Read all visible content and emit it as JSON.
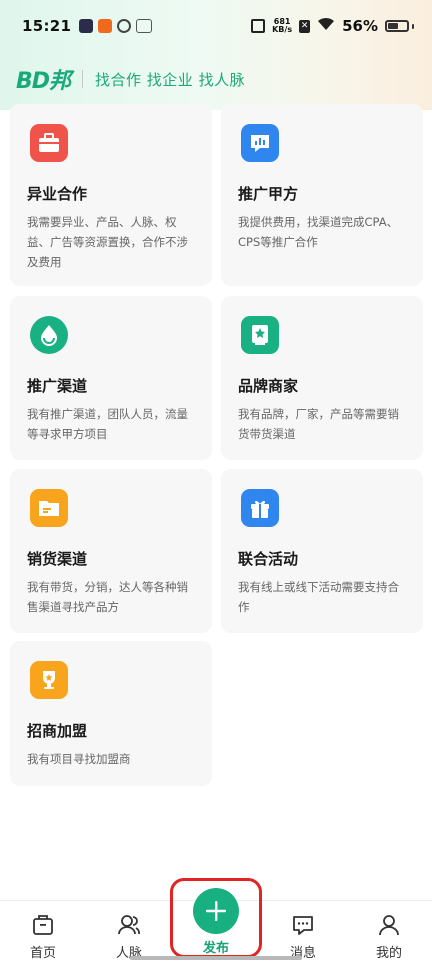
{
  "status_bar": {
    "time": "15:21",
    "net_speed_value": "681",
    "net_speed_unit": "KB/s",
    "battery_percent": "56%",
    "battery_level": 0.56
  },
  "header": {
    "logo": "BD邦",
    "slogan": "找合作 找企业 找人脉"
  },
  "cards": [
    {
      "title": "异业合作",
      "desc": "我需要异业、产品、人脉、权益、广告等资源置换，合作不涉及费用",
      "icon": "briefcase-icon",
      "color": "#f0534a"
    },
    {
      "title": "推广甲方",
      "desc": "我提供费用，找渠道完成CPA、CPS等推广合作",
      "icon": "chart-message-icon",
      "color": "#2f86ee"
    },
    {
      "title": "推广渠道",
      "desc": "我有推广渠道，团队人员，流量等寻求甲方项目",
      "icon": "droplet-icon",
      "color": "#19b184"
    },
    {
      "title": "品牌商家",
      "desc": "我有品牌，厂家，产品等需要销货带货渠道",
      "icon": "brand-book-icon",
      "color": "#19b184"
    },
    {
      "title": "销货渠道",
      "desc": "我有带货，分销，达人等各种销售渠道寻找产品方",
      "icon": "folder-icon",
      "color": "#f8a51d"
    },
    {
      "title": "联合活动",
      "desc": "我有线上或线下活动需要支持合作",
      "icon": "gift-icon",
      "color": "#2f86ee"
    },
    {
      "title": "招商加盟",
      "desc": "我有项目寻找加盟商",
      "icon": "trophy-icon",
      "color": "#f8a51d"
    }
  ],
  "tabbar": {
    "home": "首页",
    "contacts": "人脉",
    "publish": "发布",
    "messages": "消息",
    "mine": "我的"
  }
}
